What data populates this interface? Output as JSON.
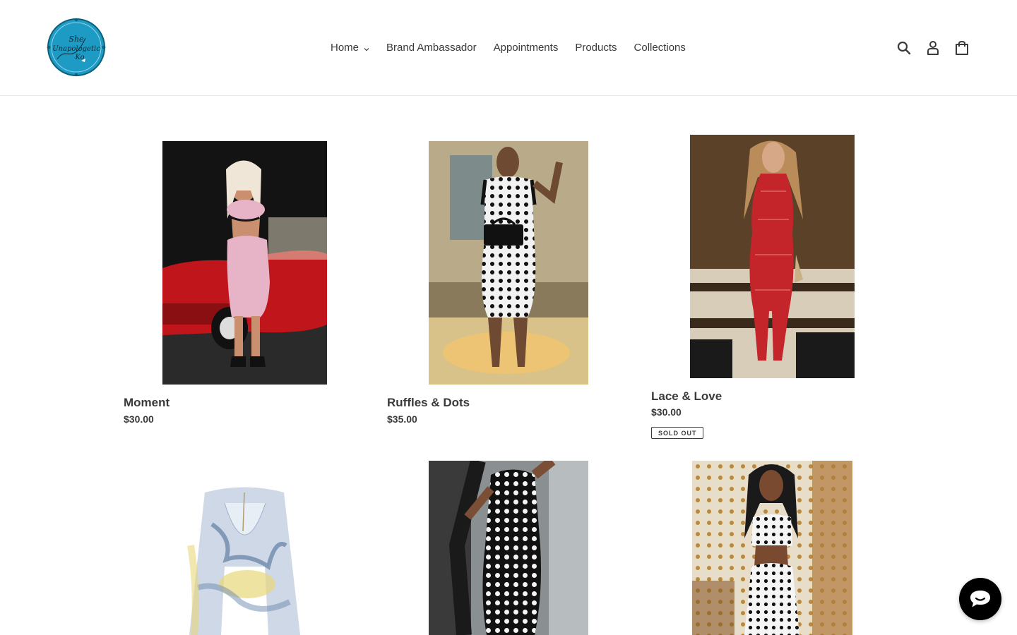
{
  "brand": {
    "logo_text": "She Unapologetic Ko",
    "accent_color": "#1e9bc4"
  },
  "nav": {
    "items": [
      {
        "label": "Home",
        "has_dropdown": true
      },
      {
        "label": "Brand Ambassador"
      },
      {
        "label": "Appointments"
      },
      {
        "label": "Products"
      },
      {
        "label": "Collections"
      }
    ]
  },
  "header_icons": [
    "search-icon",
    "account-icon",
    "cart-icon"
  ],
  "products": [
    {
      "title": "Moment",
      "price": "$30.00"
    },
    {
      "title": "Ruffles & Dots",
      "price": "$35.00"
    },
    {
      "title": "Lace & Love",
      "price": "$30.00",
      "badge": "SOLD OUT"
    },
    {
      "title": "",
      "price": ""
    },
    {
      "title": "",
      "price": ""
    },
    {
      "title": "",
      "price": ""
    }
  ],
  "chat": {
    "icon": "chat-icon",
    "color": "#000000"
  }
}
